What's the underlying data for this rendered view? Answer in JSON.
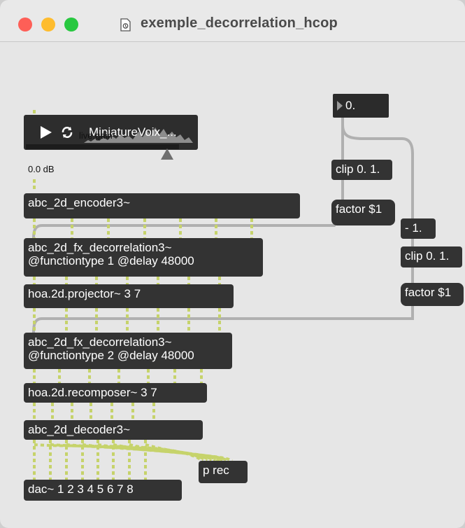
{
  "window": {
    "title": "exemple_decorrelation_hcop"
  },
  "player": {
    "file_name": "MiniatureVoix_..."
  },
  "gain": {
    "label": "live.gain~",
    "value": "0.0 dB",
    "level_fraction": 0.88
  },
  "number_box": {
    "value": "0."
  },
  "objects": {
    "encoder": "abc_2d_encoder3~",
    "decor1_line1": "abc_2d_fx_decorrelation3~",
    "decor1_line2": "@functiontype 1 @delay 48000",
    "projector": "hoa.2d.projector~ 3 7",
    "decor2_line1": "abc_2d_fx_decorrelation3~",
    "decor2_line2": "@functiontype 2 @delay 48000",
    "recomposer": "hoa.2d.recomposer~ 3 7",
    "decoder": "abc_2d_decoder3~",
    "dac": "dac~ 1 2 3 4 5 6 7 8",
    "prec": "p rec",
    "clip1": "clip 0. 1.",
    "factor1": "factor $1",
    "minus": "- 1.",
    "clip2": "clip 0. 1.",
    "factor2": "factor $1"
  },
  "colors": {
    "object_bg": "#333333",
    "canvas_bg": "#e6e6e6",
    "signal_cord": "#d9e58a",
    "control_cord": "#b8b8b8"
  },
  "icons": {
    "close": "traffic-close",
    "minimize": "traffic-minimize",
    "zoom": "traffic-zoom",
    "document": "max-patch-document-icon",
    "play": "play-icon",
    "loop": "loop-icon"
  }
}
